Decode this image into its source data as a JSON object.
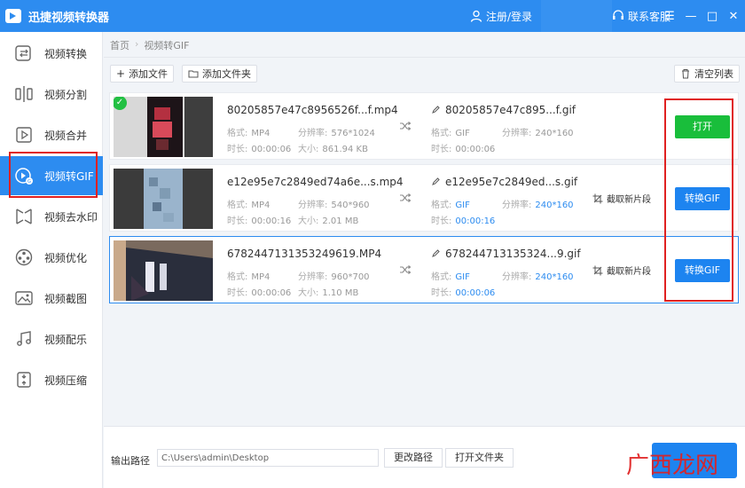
{
  "titlebar": {
    "app_title": "迅捷视频转换器",
    "login": "注册/登录",
    "support": "联系客服",
    "minimize": "—",
    "maximize": "□",
    "close": "✕",
    "menu": "☰"
  },
  "sidebar": {
    "items": [
      {
        "label": "视频转换",
        "icon": "video-convert-icon"
      },
      {
        "label": "视频分割",
        "icon": "video-split-icon"
      },
      {
        "label": "视频合并",
        "icon": "video-merge-icon"
      },
      {
        "label": "视频转GIF",
        "icon": "video-to-gif-icon"
      },
      {
        "label": "视频去水印",
        "icon": "remove-watermark-icon"
      },
      {
        "label": "视频优化",
        "icon": "video-optimize-icon"
      },
      {
        "label": "视频截图",
        "icon": "video-screenshot-icon"
      },
      {
        "label": "视频配乐",
        "icon": "video-music-icon"
      },
      {
        "label": "视频压缩",
        "icon": "video-compress-icon"
      }
    ],
    "active_index": 3
  },
  "breadcrumb": {
    "home": "首页",
    "sep": "›",
    "current": "视频转GIF"
  },
  "toolbar": {
    "add_file": "添加文件",
    "add_folder": "添加文件夹",
    "clear_list": "清空列表"
  },
  "files": [
    {
      "src_name": "80205857e47c8956526f...f.mp4",
      "src_format_k": "格式:",
      "src_format": "MP4",
      "src_res_k": "分辨率:",
      "src_res": "576*1024",
      "src_dur_k": "时长:",
      "src_dur": "00:00:06",
      "src_size_k": "大小:",
      "src_size": "861.94 KB",
      "dst_name": "80205857e47c895...f.gif",
      "dst_format_k": "格式:",
      "dst_format": "GIF",
      "dst_res_k": "分辨率:",
      "dst_res": "240*160",
      "dst_dur_k": "时长:",
      "dst_dur": "00:00:06",
      "action": "打开",
      "action_state": "done"
    },
    {
      "src_name": "e12e95e7c2849ed74a6e...s.mp4",
      "src_format_k": "格式:",
      "src_format": "MP4",
      "src_res_k": "分辨率:",
      "src_res": "540*960",
      "src_dur_k": "时长:",
      "src_dur": "00:00:16",
      "src_size_k": "大小:",
      "src_size": "2.01 MB",
      "dst_name": "e12e95e7c2849ed...s.gif",
      "dst_format_k": "格式:",
      "dst_format": "GIF",
      "dst_res_k": "分辨率:",
      "dst_res": "240*160",
      "dst_dur_k": "时长:",
      "dst_dur": "00:00:16",
      "cut_clip": "截取新片段",
      "action": "转换GIF",
      "action_state": "pending"
    },
    {
      "src_name": "6782447131353249619.MP4",
      "src_format_k": "格式:",
      "src_format": "MP4",
      "src_res_k": "分辨率:",
      "src_res": "960*700",
      "src_dur_k": "时长:",
      "src_dur": "00:00:06",
      "src_size_k": "大小:",
      "src_size": "1.10 MB",
      "dst_name": "678244713135324...9.gif",
      "dst_format_k": "格式:",
      "dst_format": "GIF",
      "dst_res_k": "分辨率:",
      "dst_res": "240*160",
      "dst_dur_k": "时长:",
      "dst_dur": "00:00:06",
      "cut_clip": "截取新片段",
      "action": "转换GIF",
      "action_state": "pending"
    }
  ],
  "bottom": {
    "output_label": "输出路径",
    "output_path": "C:\\Users\\admin\\Desktop",
    "change_path": "更改路径",
    "open_folder": "打开文件夹"
  },
  "watermark": "广西龙网",
  "colors": {
    "primary": "#2d8cf0",
    "open_button": "#19be3b",
    "highlight_box": "#e02020"
  }
}
